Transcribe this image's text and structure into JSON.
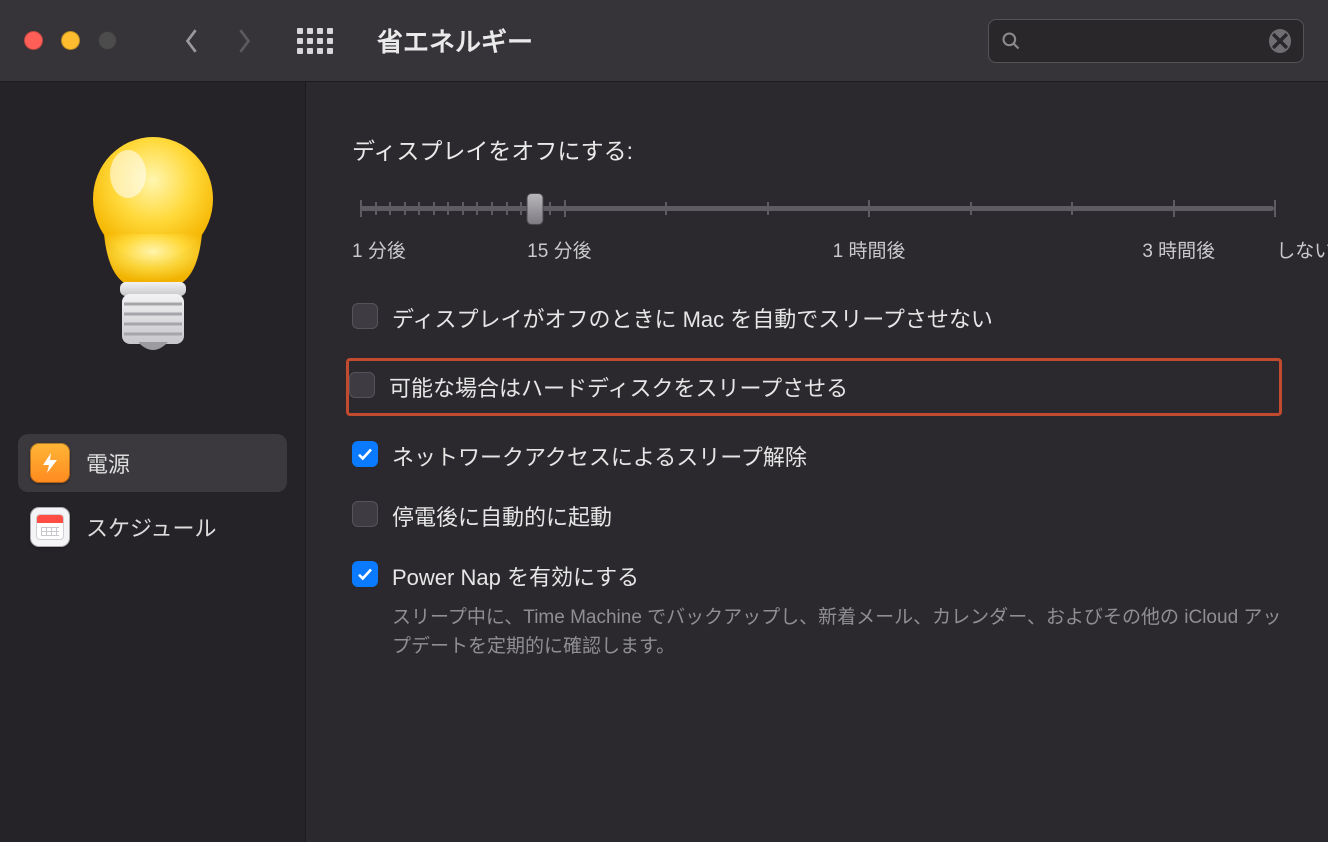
{
  "titlebar": {
    "title": "省エネルギー",
    "search_placeholder": ""
  },
  "sidebar": {
    "items": [
      {
        "label": "電源",
        "active": true
      },
      {
        "label": "スケジュール",
        "active": false
      }
    ]
  },
  "main": {
    "slider_title": "ディスプレイをオフにする:",
    "slider": {
      "ticks": [
        "1 分後",
        "15 分後",
        "1 時間後",
        "3 時間後",
        "しない"
      ],
      "tick_positions_pct": [
        0,
        22.3,
        55.6,
        88.9,
        100
      ],
      "major_tick_positions_pct": [
        0,
        22.3,
        55.6,
        88.9,
        100
      ],
      "minor_count_before_major": [
        0,
        13,
        2,
        2,
        0
      ],
      "value_pct": 19.2
    },
    "options": [
      {
        "checked": false,
        "label": "ディスプレイがオフのときに Mac を自動でスリープさせない",
        "highlight": false
      },
      {
        "checked": false,
        "label": "可能な場合はハードディスクをスリープさせる",
        "highlight": true
      },
      {
        "checked": true,
        "label": "ネットワークアクセスによるスリープ解除",
        "highlight": false
      },
      {
        "checked": false,
        "label": "停電後に自動的に起動",
        "highlight": false
      },
      {
        "checked": true,
        "label": "Power Nap を有効にする",
        "highlight": false,
        "desc": "スリープ中に、Time Machine でバックアップし、新着メール、カレンダー、およびその他の iCloud アップデートを定期的に確認します。"
      }
    ]
  }
}
